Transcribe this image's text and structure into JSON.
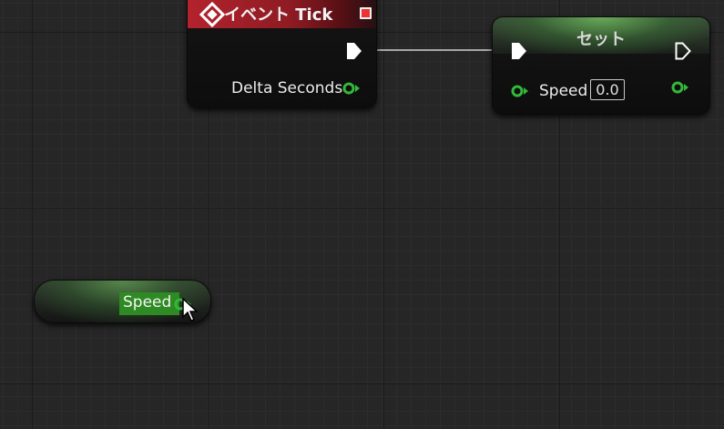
{
  "colors": {
    "exec": "#ffffff",
    "float_pin": "#33b83a",
    "event_header": "#b3232d",
    "variable_header": "#5aa54a",
    "get_highlight": "#2e8a22"
  },
  "event_tick_node": {
    "title": "イベント Tick",
    "icon": "event-diamond-icon",
    "output_pins": [
      {
        "label": "",
        "type": "exec"
      },
      {
        "label": "Delta Seconds",
        "type": "float"
      }
    ]
  },
  "set_node": {
    "title": "セット",
    "input_pins": [
      {
        "label": "",
        "type": "exec"
      },
      {
        "label": "Speed",
        "type": "float",
        "default_value": "0.0"
      }
    ],
    "output_pins": [
      {
        "label": "",
        "type": "exec"
      },
      {
        "label": "",
        "type": "float"
      }
    ]
  },
  "get_node": {
    "label": "Speed",
    "type": "float"
  },
  "connections": [
    {
      "from": "イベント Tick.exec",
      "to": "セット.exec"
    }
  ]
}
